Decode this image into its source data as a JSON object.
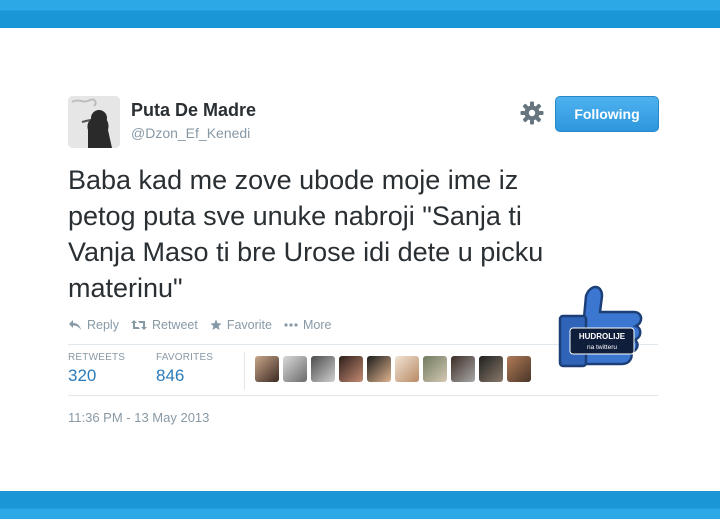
{
  "user": {
    "display_name": "Puta De Madre",
    "handle": "@Dzon_Ef_Kenedi",
    "avatar_icon": "smoking-silhouette-avatar"
  },
  "follow_button": {
    "label": "Following",
    "color": "#3aa3e8"
  },
  "settings_icon": "gear-icon",
  "tweet": {
    "text": "Baba kad me zove ubode moje ime iz\npetog puta sve unuke nabroji \"Sanja ti\nVanja Maso ti bre  Urose idi dete u picku\nmaterinu\""
  },
  "actions": {
    "reply": "Reply",
    "retweet": "Retweet",
    "favorite": "Favorite",
    "more": "More"
  },
  "stats": {
    "retweets_label": "RETWEETS",
    "retweets_value": "320",
    "favorites_label": "FAVORITES",
    "favorites_value": "846"
  },
  "favoriters_count_shown": 10,
  "timestamp": "11:36 PM - 13 May 2013",
  "badge": {
    "line1": "HUDROLIJE",
    "line2": "na twitteru"
  },
  "colors": {
    "band": "#1a95d6",
    "link": "#2b7bb9",
    "muted": "#8899a6"
  }
}
